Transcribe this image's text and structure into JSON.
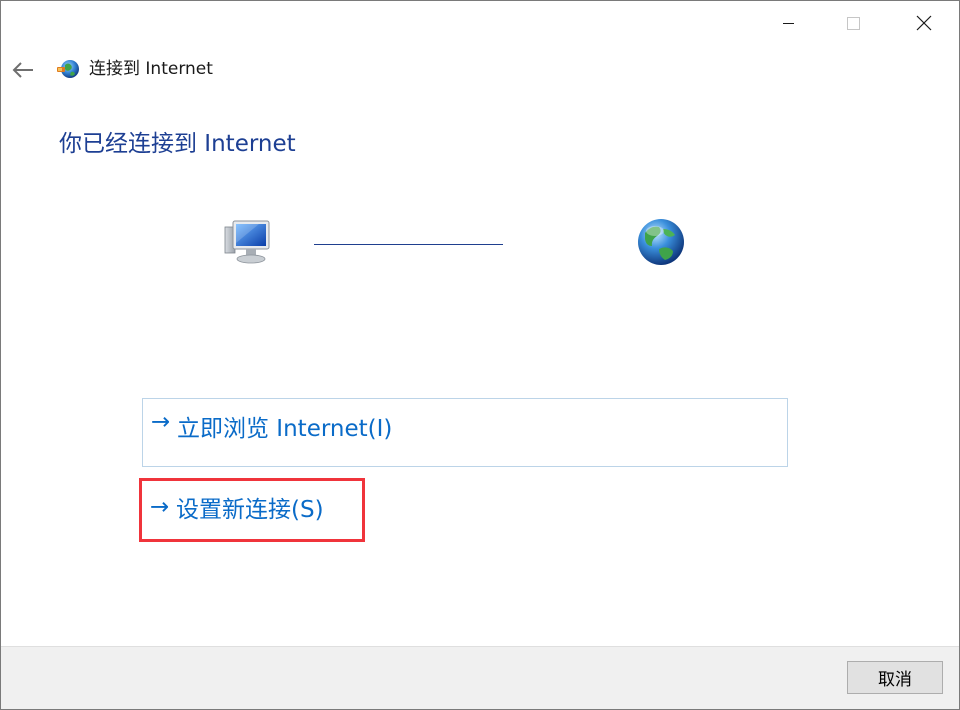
{
  "window": {
    "title": "连接到 Internet"
  },
  "main": {
    "heading": "你已经连接到 Internet"
  },
  "commands": {
    "arrow": "→",
    "browse_label": "立即浏览 Internet(I)",
    "new_connection_label": "设置新连接(S)"
  },
  "footer": {
    "cancel_label": "取消"
  },
  "colors": {
    "heading": "#1d3f93",
    "link": "#0a6bc8",
    "highlight_box": "#f0343b",
    "footer_bg": "#f0f0f0"
  },
  "icons": {
    "back": "back-arrow-icon",
    "header": "network-globe-icon",
    "computer": "computer-icon",
    "internet": "globe-icon",
    "minimize": "minimize-icon",
    "maximize": "maximize-icon",
    "close": "close-icon"
  }
}
